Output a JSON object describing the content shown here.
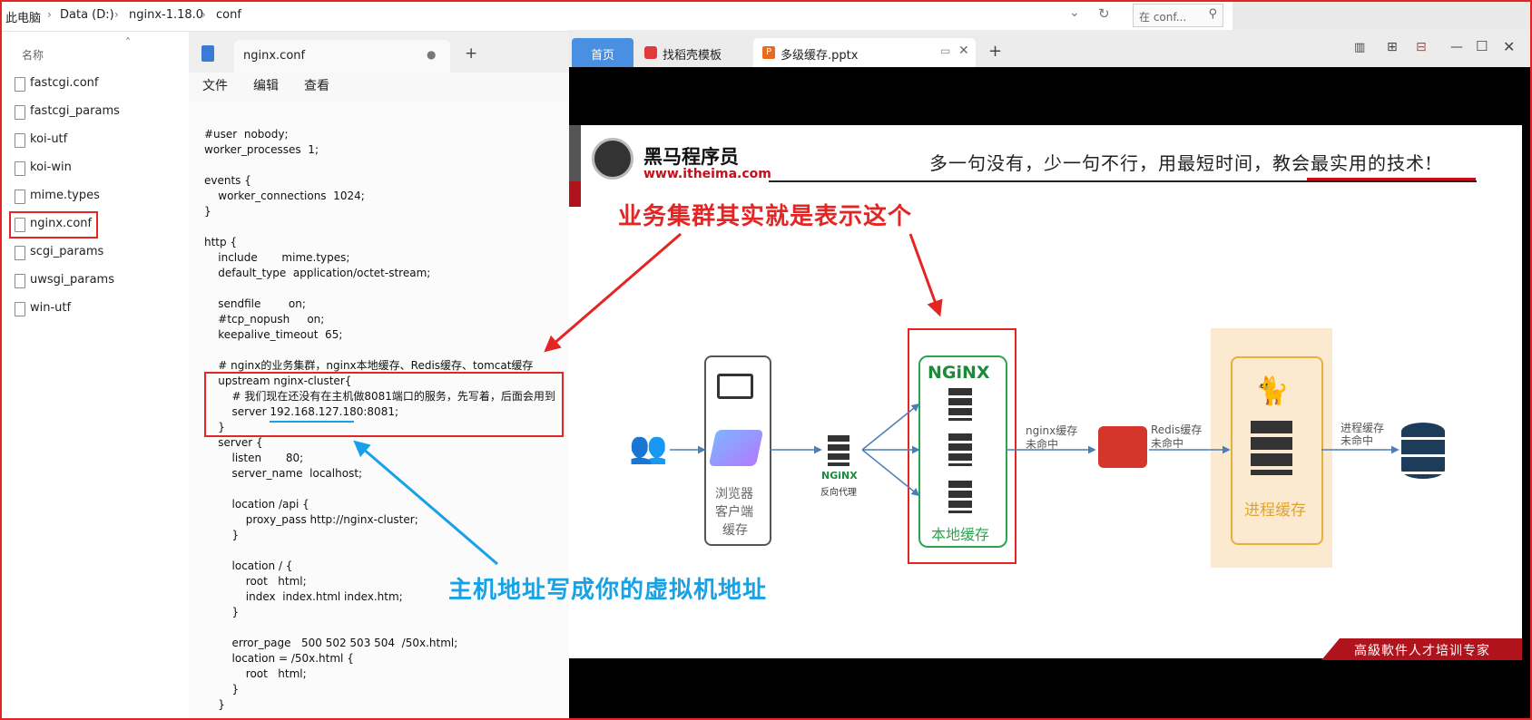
{
  "address": {
    "crumbs": [
      "此电脑",
      "Data (D:)",
      "nginx-1.18.0",
      "conf"
    ],
    "search_placeholder": "在 conf..."
  },
  "file_list": {
    "column_header": "名称",
    "files": [
      "fastcgi.conf",
      "fastcgi_params",
      "koi-utf",
      "koi-win",
      "mime.types",
      "nginx.conf",
      "scgi_params",
      "uwsgi_params",
      "win-utf"
    ],
    "selected": "nginx.conf"
  },
  "notepad": {
    "tab_title": "nginx.conf",
    "new_tab": "+",
    "menu": [
      "文件",
      "编辑",
      "查看"
    ],
    "code": [
      "#user  nobody;",
      "worker_processes  1;",
      "",
      "events {",
      "    worker_connections  1024;",
      "}",
      "",
      "http {",
      "    include       mime.types;",
      "    default_type  application/octet-stream;",
      "",
      "    sendfile        on;",
      "    #tcp_nopush     on;",
      "    keepalive_timeout  65;",
      "",
      "    # nginx的业务集群，nginx本地缓存、Redis缓存、tomcat缓存",
      "    upstream nginx-cluster{",
      "        # 我们现在还没有在主机做8081端口的服务，先写着，后面会用到",
      "        server 192.168.127.180:8081;",
      "    }",
      "    server {",
      "        listen       80;",
      "        server_name  localhost;",
      "",
      "        location /api {",
      "            proxy_pass http://nginx-cluster;",
      "        }",
      "",
      "        location / {",
      "            root   html;",
      "            index  index.html index.htm;",
      "        }",
      "",
      "        error_page   500 502 503 504  /50x.html;",
      "        location = /50x.html {",
      "            root   html;",
      "        }",
      "    }"
    ]
  },
  "ppt": {
    "tabs": [
      "首页",
      "找稻壳模板",
      "多级缓存.pptx"
    ],
    "new_tab": "+",
    "slide": {
      "logo_cn": "黑马程序员",
      "logo_url": "www.itheima.com",
      "slogan": "多一句没有，少一句不行，用最短时间，教会最实用的技术!",
      "annotation_top": "业务集群其实就是表示这个",
      "annotation_bottom": "主机地址写成你的虚拟机地址",
      "browser_label": [
        "浏览器",
        "客户端",
        "缓存"
      ],
      "nginx_proxy": "NGiNX",
      "reverse_proxy": "反向代理",
      "nginx_cluster_logo": "NGiNX",
      "local_cache": "本地缓存",
      "nginx_miss": [
        "nginx缓存",
        "未命中"
      ],
      "redis_miss": [
        "Redis缓存",
        "未命中"
      ],
      "process_miss": [
        "进程缓存",
        "未命中"
      ],
      "process_cache": "进程缓存",
      "footer": "高級軟件人才培训专家"
    }
  },
  "colors": {
    "red": "#e52424",
    "blue": "#17a1e6",
    "green": "#2ea44f",
    "tab_blue": "#4a90e2"
  }
}
